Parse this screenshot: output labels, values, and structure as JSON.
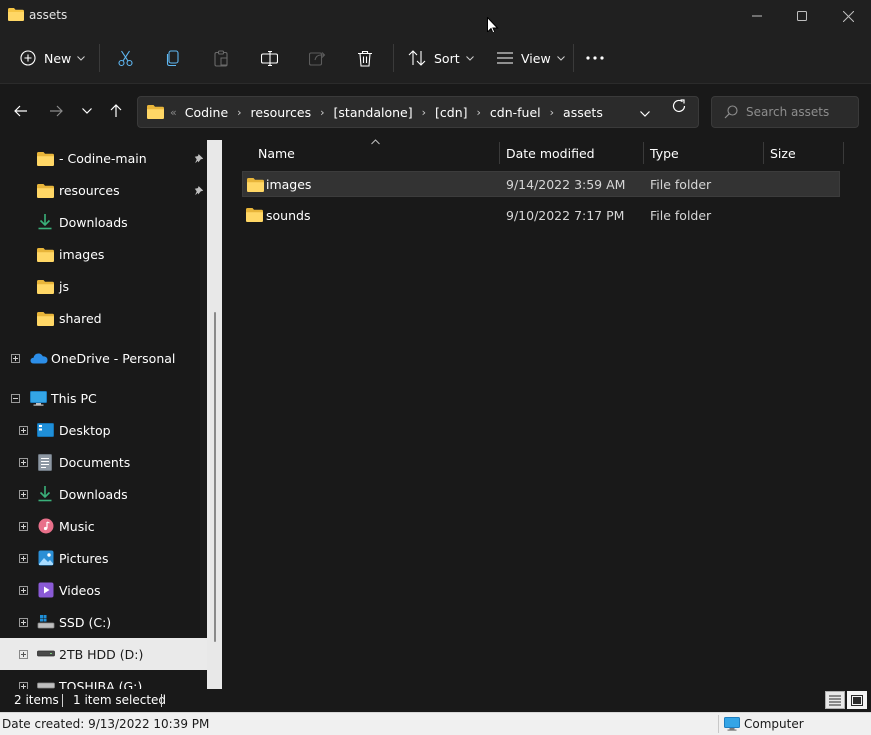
{
  "window": {
    "title": "assets"
  },
  "commandbar": {
    "new_label": "New",
    "sort_label": "Sort",
    "view_label": "View"
  },
  "address": {
    "overflow": "«",
    "crumbs": [
      "Codine",
      "resources",
      "[standalone]",
      "[cdn]",
      "cdn-fuel",
      "assets"
    ]
  },
  "search": {
    "placeholder": "Search assets"
  },
  "navpane": {
    "quick_access": [
      {
        "label": "- Codine-main",
        "icon": "folder-icon",
        "pinned": true
      },
      {
        "label": "resources",
        "icon": "folder-icon",
        "pinned": true
      },
      {
        "label": "Downloads",
        "icon": "downloads-icon",
        "pinned": false
      },
      {
        "label": "images",
        "icon": "folder-icon",
        "pinned": false
      },
      {
        "label": "js",
        "icon": "folder-icon",
        "pinned": false
      },
      {
        "label": "shared",
        "icon": "folder-icon",
        "pinned": false
      }
    ],
    "onedrive": "OneDrive - Personal",
    "this_pc": "This PC",
    "pc_items": [
      {
        "label": "Desktop",
        "icon": "desktop-icon"
      },
      {
        "label": "Documents",
        "icon": "documents-icon"
      },
      {
        "label": "Downloads",
        "icon": "downloads-icon"
      },
      {
        "label": "Music",
        "icon": "music-icon"
      },
      {
        "label": "Pictures",
        "icon": "pictures-icon"
      },
      {
        "label": "Videos",
        "icon": "videos-icon"
      },
      {
        "label": "SSD (C:)",
        "icon": "drive-c-icon"
      },
      {
        "label": "2TB HDD (D:)",
        "icon": "drive-icon"
      },
      {
        "label": "TOSHIBA (G:)",
        "icon": "drive-icon"
      }
    ]
  },
  "columns": {
    "name": "Name",
    "date": "Date modified",
    "type": "Type",
    "size": "Size"
  },
  "files": [
    {
      "name": "images",
      "date": "9/14/2022 3:59 AM",
      "type": "File folder",
      "size": ""
    },
    {
      "name": "sounds",
      "date": "9/10/2022 7:17 PM",
      "type": "File folder",
      "size": ""
    }
  ],
  "status": {
    "item_count": "2 items",
    "selected": "1 item selected",
    "date_created": "Date created: 9/13/2022 10:39 PM",
    "location": "Computer"
  },
  "colors": {
    "folder": "#f6c544",
    "accent": "#4cc2ff"
  }
}
